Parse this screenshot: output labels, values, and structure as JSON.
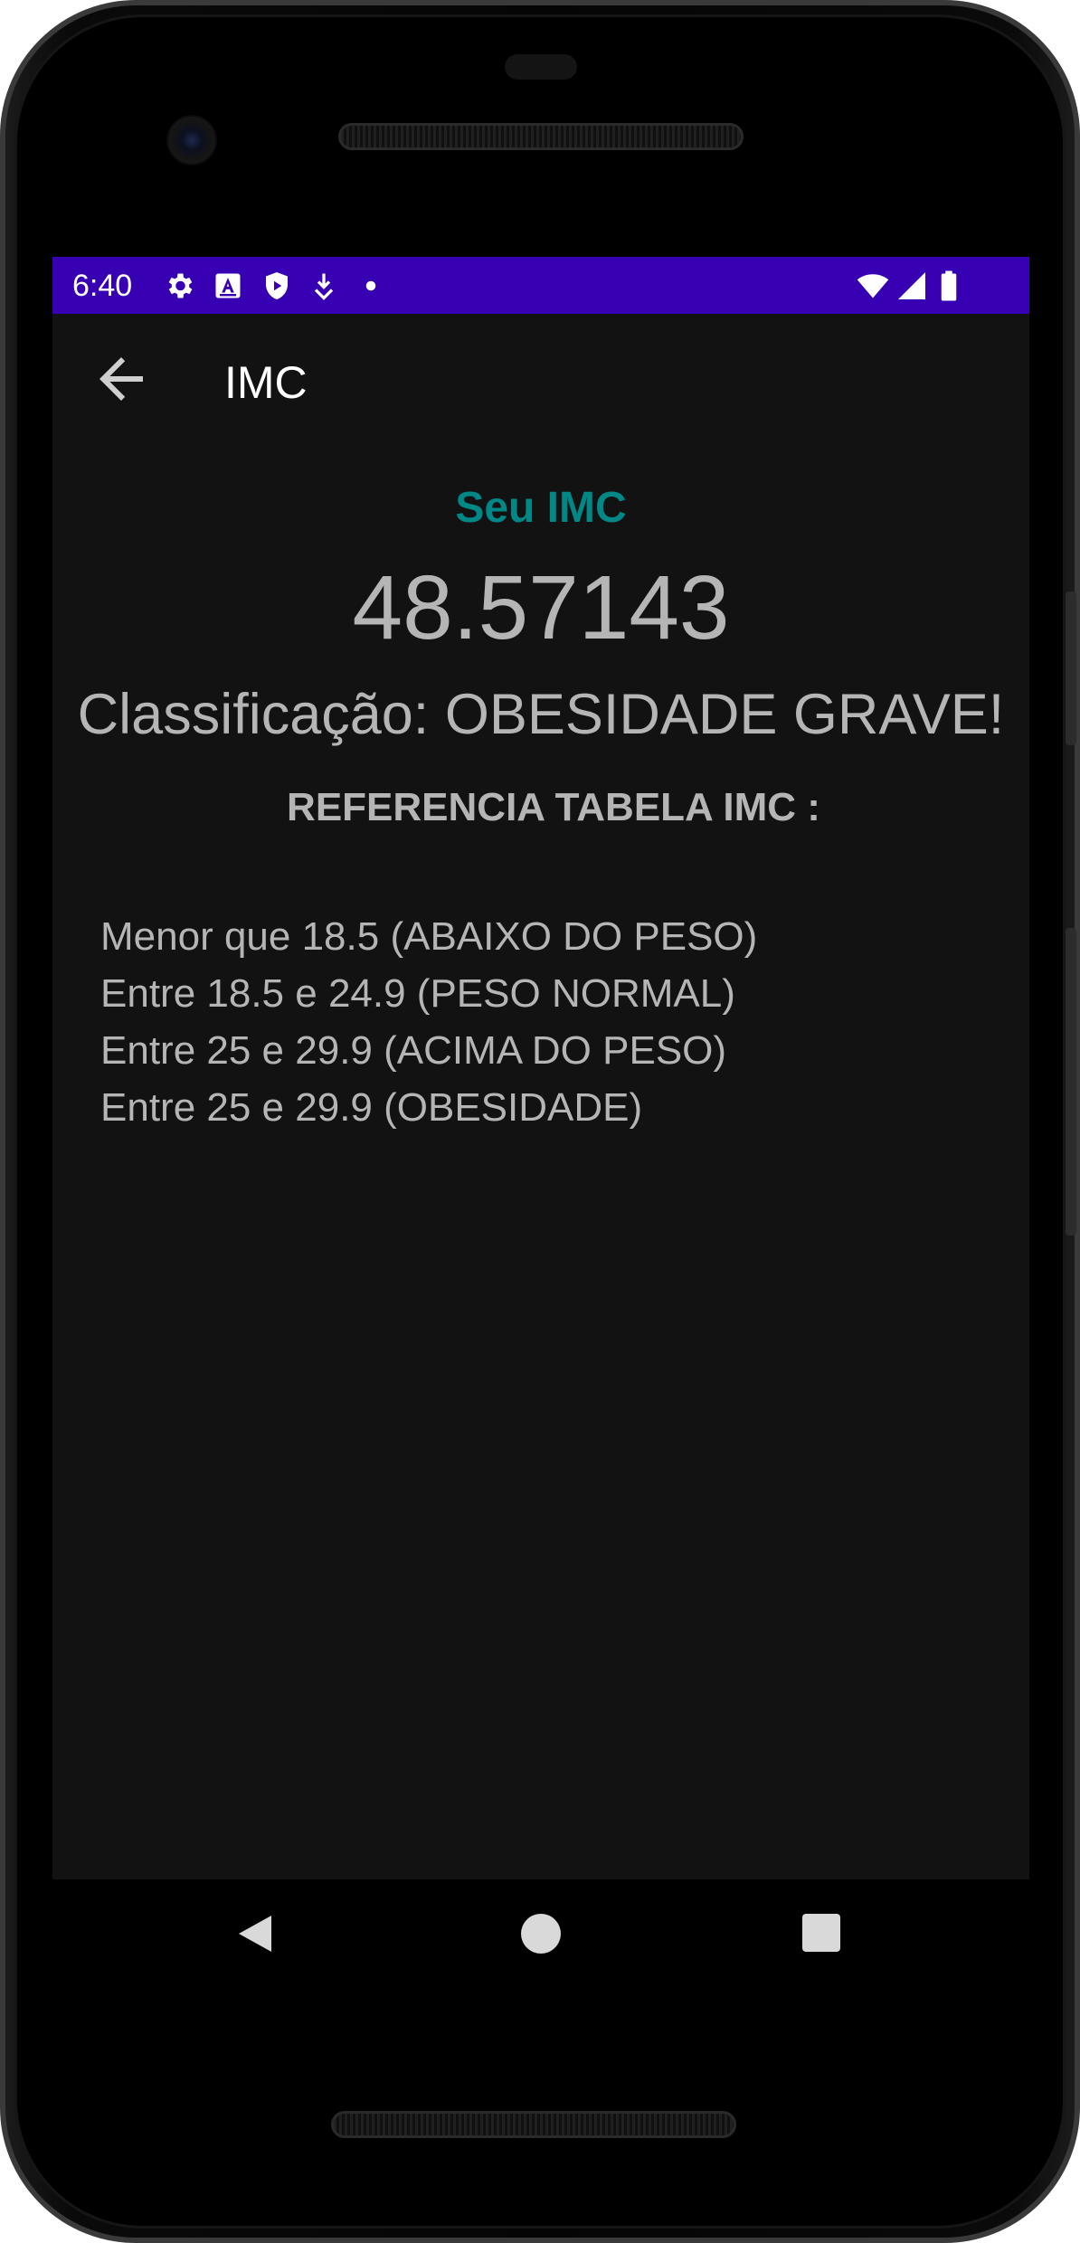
{
  "status_bar": {
    "time": "6:40",
    "background_color": "#3700b3",
    "left_icons": [
      "gear-icon",
      "app-store-icon",
      "shield-play-icon",
      "download-icon",
      "dot-icon"
    ],
    "right_icons": [
      "wifi-icon",
      "signal-icon",
      "battery-icon"
    ]
  },
  "app_bar": {
    "title": "IMC",
    "back_icon": "arrow-left-icon"
  },
  "main": {
    "result_label": "Seu IMC",
    "result_label_color": "#018786",
    "imc_value": "48.57143",
    "classification": "Classificação: OBESIDADE GRAVE!",
    "reference_title": "REFERENCIA TABELA IMC :",
    "reference_items": [
      "Menor que 18.5 (ABAIXO DO PESO)",
      "Entre 18.5 e 24.9 (PESO NORMAL)",
      "Entre 25 e 29.9 (ACIMA DO PESO)",
      "Entre 25 e 29.9 (OBESIDADE)"
    ]
  },
  "nav_bar": {
    "buttons": [
      "nav-back-icon",
      "nav-home-icon",
      "nav-recents-icon"
    ]
  },
  "colors": {
    "screen_background": "#121212",
    "text_primary": "#b5b5b5"
  }
}
